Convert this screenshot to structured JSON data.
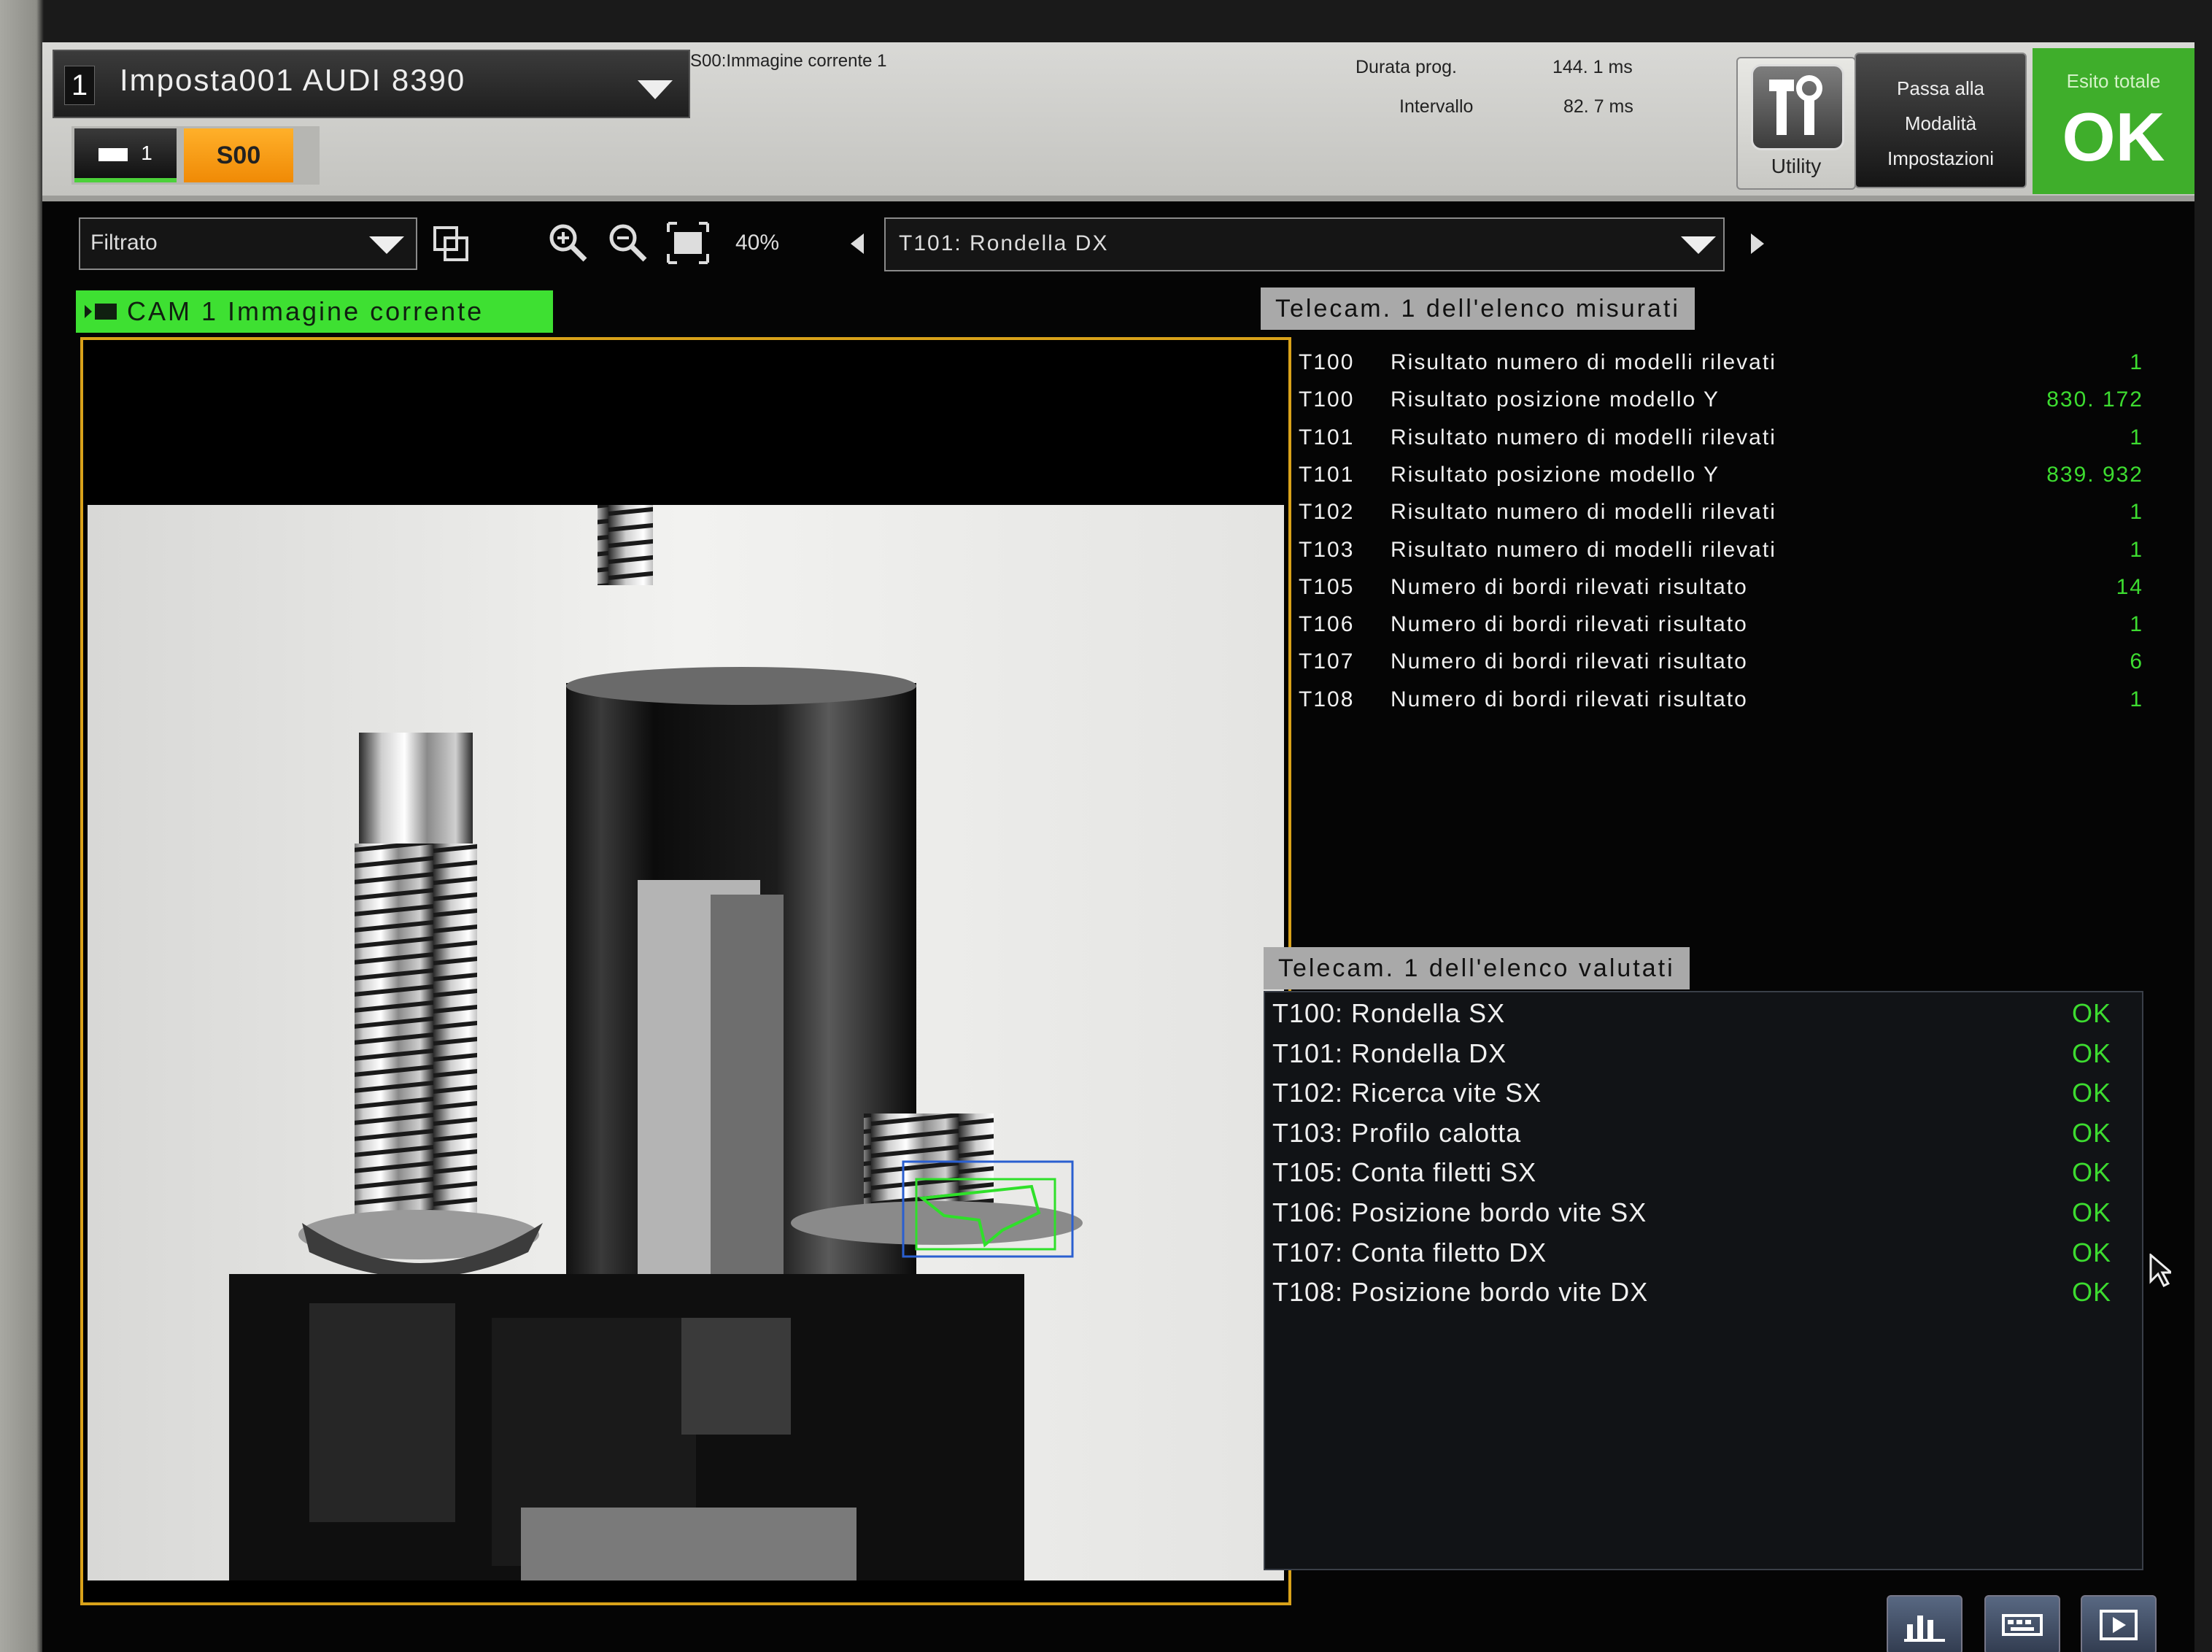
{
  "program": {
    "number": "1",
    "name": "Imposta001  AUDI  8390",
    "scene_label": "S00:Immagine  corrente  1"
  },
  "scene_tabs": {
    "camera_tab": "1",
    "scene": "S00"
  },
  "stats": {
    "duration_label": "Durata prog.",
    "duration_value": "144. 1  ms",
    "interval_label": "Intervallo",
    "interval_value": "82. 7  ms"
  },
  "buttons": {
    "utility": "Utility",
    "mode_line1": "Passa  alla",
    "mode_line2": "Modalità",
    "mode_line3": "Impostazioni"
  },
  "total_result": {
    "label": "Esito  totale",
    "value": "OK",
    "color": "#3fae2b"
  },
  "toolbar": {
    "filter": "Filtrato",
    "zoom": "40%",
    "tool": "T101:  Rondella  DX"
  },
  "image_panel": {
    "camera_label": "CAM  1  Immagine  corrente",
    "frame_color": "#d9a21a"
  },
  "measured": {
    "title": "Telecam.  1  dell'elenco  misurati",
    "rows": [
      {
        "id": "T100",
        "desc": "Risultato  numero  di  modelli  rilevati",
        "value": "1"
      },
      {
        "id": "T100",
        "desc": "Risultato  posizione  modello  Y",
        "value": "830. 172"
      },
      {
        "id": "T101",
        "desc": "Risultato  numero  di  modelli  rilevati",
        "value": "1"
      },
      {
        "id": "T101",
        "desc": "Risultato  posizione  modello  Y",
        "value": "839. 932"
      },
      {
        "id": "T102",
        "desc": "Risultato  numero  di  modelli  rilevati",
        "value": "1"
      },
      {
        "id": "T103",
        "desc": "Risultato  numero  di  modelli  rilevati",
        "value": "1"
      },
      {
        "id": "T105",
        "desc": "Numero  di  bordi  rilevati  risultato",
        "value": "14"
      },
      {
        "id": "T106",
        "desc": "Numero  di  bordi  rilevati  risultato",
        "value": "1"
      },
      {
        "id": "T107",
        "desc": "Numero  di  bordi  rilevati  risultato",
        "value": "6"
      },
      {
        "id": "T108",
        "desc": "Numero  di  bordi  rilevati  risultato",
        "value": "1"
      }
    ]
  },
  "evaluated": {
    "title": "Telecam.  1  dell'elenco  valutati",
    "rows": [
      {
        "name": "T100:  Rondella  SX",
        "result": "OK"
      },
      {
        "name": "T101:  Rondella  DX",
        "result": "OK"
      },
      {
        "name": "T102:  Ricerca  vite  SX",
        "result": "OK"
      },
      {
        "name": "T103:  Profilo  calotta",
        "result": "OK"
      },
      {
        "name": "T105:  Conta  filetti  SX",
        "result": "OK"
      },
      {
        "name": "T106:  Posizione  bordo  vite  SX",
        "result": "OK"
      },
      {
        "name": "T107:  Conta  filetto  DX",
        "result": "OK"
      },
      {
        "name": "T108:  Posizione  bordo  vite  DX",
        "result": "OK"
      }
    ]
  },
  "bottom_buttons": [
    "chart-icon",
    "keyboard-icon",
    "play-icon"
  ]
}
